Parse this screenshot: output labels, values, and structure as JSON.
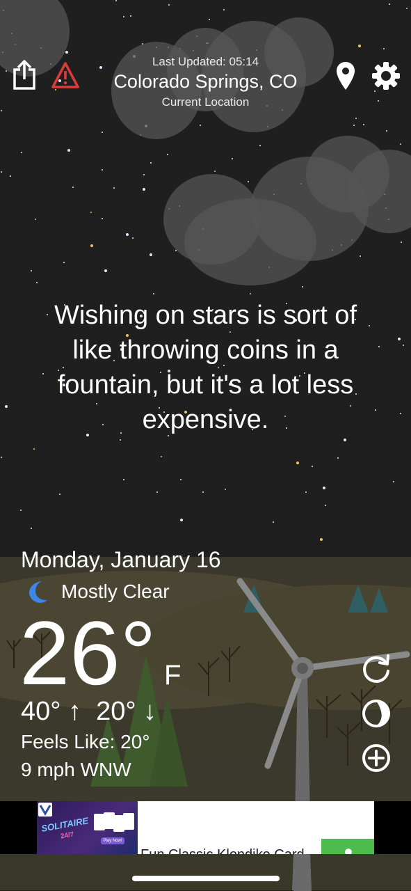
{
  "header": {
    "last_updated": "Last Updated: 05:14",
    "city": "Colorado Springs, CO",
    "location_label": "Current Location"
  },
  "quote": "Wishing on stars is sort of like throwing coins in a fountain, but it's a lot less expensive.",
  "weather": {
    "date": "Monday, January 16",
    "condition": "Mostly Clear",
    "temperature": "26°",
    "unit": "F",
    "hi_lo": "40° ↑  20° ↓",
    "feels_like": "Feels Like: 20°",
    "wind": "9 mph WNW"
  },
  "ad": {
    "logo_text": "SOLITAIRE",
    "logo_sub": "24/7",
    "play_button": "Play Now!",
    "headline": "Fun Classic Klondike Card"
  },
  "icons": {
    "share": "share-icon",
    "alert": "warning-icon",
    "location": "location-pin-icon",
    "settings": "gear-icon",
    "moon": "moon-icon",
    "refresh": "refresh-icon",
    "theme": "theme-icon",
    "add": "add-icon"
  },
  "colors": {
    "alert_red": "#e03b3b",
    "moon_blue": "#3d86e6",
    "ad_green": "#4dbb4d"
  }
}
